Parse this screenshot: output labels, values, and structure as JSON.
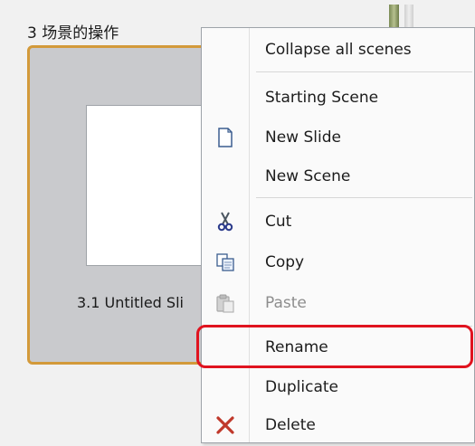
{
  "scene": {
    "title": "3 场景的操作",
    "slide_label": "3.1 Untitled Sli"
  },
  "menu": {
    "items": [
      {
        "id": "collapse",
        "label": "Collapse all scenes",
        "icon": "",
        "enabled": true
      },
      {
        "id": "starting",
        "label": "Starting Scene",
        "icon": "",
        "enabled": true
      },
      {
        "id": "new-slide",
        "label": "New Slide",
        "icon": "new-slide-icon",
        "enabled": true
      },
      {
        "id": "new-scene",
        "label": "New Scene",
        "icon": "",
        "enabled": true
      },
      {
        "id": "cut",
        "label": "Cut",
        "icon": "scissors-icon",
        "enabled": true
      },
      {
        "id": "copy",
        "label": "Copy",
        "icon": "copy-icon",
        "enabled": true
      },
      {
        "id": "paste",
        "label": "Paste",
        "icon": "paste-icon",
        "enabled": false
      },
      {
        "id": "rename",
        "label": "Rename",
        "icon": "",
        "enabled": true,
        "highlighted": true
      },
      {
        "id": "duplicate",
        "label": "Duplicate",
        "icon": "",
        "enabled": true
      },
      {
        "id": "delete",
        "label": "Delete",
        "icon": "delete-x-icon",
        "enabled": true
      }
    ]
  },
  "colors": {
    "scene_border": "#d39a3a",
    "highlight_border": "#e0131f",
    "delete_icon": "#c0392b"
  }
}
